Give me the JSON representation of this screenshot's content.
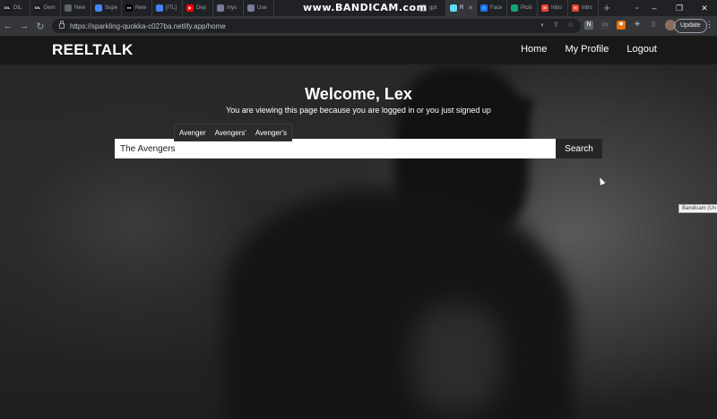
{
  "browser": {
    "tabs": [
      {
        "label": "DIL",
        "favicon_text": "DIL",
        "favicon_color": "#1a1a1a"
      },
      {
        "label": "Dem",
        "favicon_text": "DIL",
        "favicon_color": "#1a1a1a"
      },
      {
        "label": "New",
        "favicon_text": "",
        "favicon_color": "#5f6368"
      },
      {
        "label": "Supe",
        "favicon_text": "",
        "favicon_color": "#4285f4"
      },
      {
        "label": "New",
        "favicon_text": "●●",
        "favicon_color": "#000000"
      },
      {
        "label": "[ITL]",
        "favicon_text": "",
        "favicon_color": "#4285f4"
      },
      {
        "label": "Dep",
        "favicon_text": "▶",
        "favicon_color": "#ff0000"
      },
      {
        "label": "mys",
        "favicon_text": "",
        "favicon_color": "#7b7b9d"
      },
      {
        "label": "Use",
        "favicon_text": "",
        "favicon_color": "#7b7b9d"
      }
    ],
    "right_tabs": [
      {
        "label": "gpt",
        "favicon_text": "",
        "favicon_color": "#5f6368"
      },
      {
        "label": "R",
        "favicon_text": "",
        "favicon_color": "#61dafb"
      },
      {
        "label": "Face",
        "favicon_text": "f",
        "favicon_color": "#1877f2"
      },
      {
        "label": "Pickl",
        "favicon_text": "",
        "favicon_color": "#10a37f"
      },
      {
        "label": "Inbo",
        "favicon_text": "M",
        "favicon_color": "#ea4335"
      },
      {
        "label": "Inbo",
        "favicon_text": "M",
        "favicon_color": "#ea4335"
      }
    ],
    "watermark": "www.BANDICAM.com",
    "url": "https://sparkling-quokka-c027ba.netlify.app/home",
    "update_label": "Update"
  },
  "site": {
    "brand": "REELTALK",
    "nav": {
      "home": "Home",
      "profile": "My Profile",
      "logout": "Logout"
    },
    "welcome": "Welcome, Lex",
    "subtitle": "You are viewing this page because you are logged in or you just signed up",
    "suggestions": [
      "Avenger",
      "Avengers'",
      "Avenger's"
    ],
    "search": {
      "value": "The Avengers",
      "button": "Search"
    },
    "tooltip": "Bandicam (Un"
  }
}
